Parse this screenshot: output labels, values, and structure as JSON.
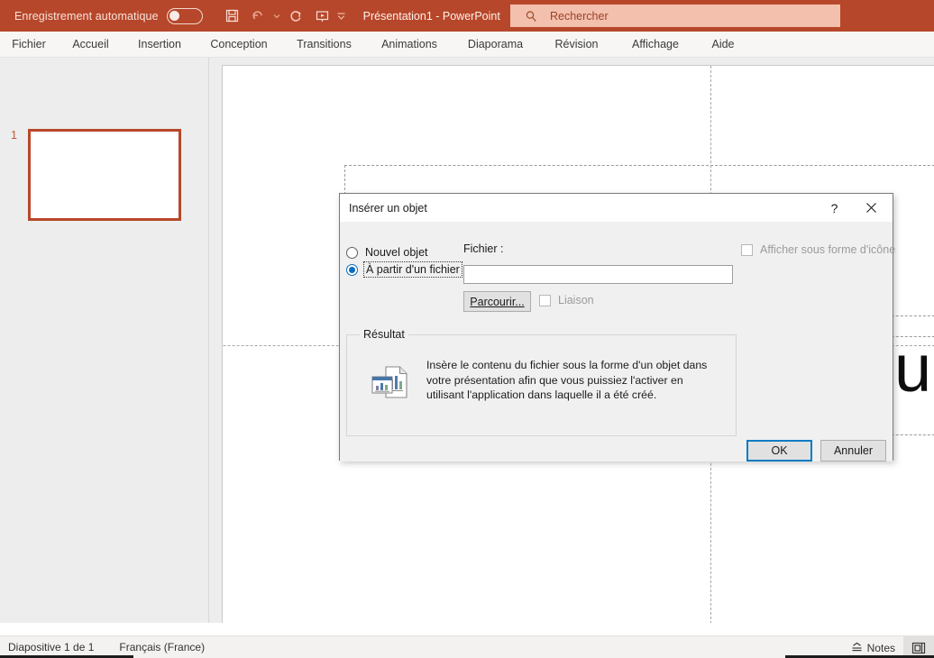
{
  "titlebar": {
    "autosave_label": "Enregistrement automatique",
    "autosave_state": "off",
    "qat": [
      {
        "name": "save-icon",
        "tooltip": "Enregistrer"
      },
      {
        "name": "undo-icon",
        "tooltip": "Annuler"
      },
      {
        "name": "undo-dropdown-icon",
        "tooltip": "Annuler (options)"
      },
      {
        "name": "redo-icon",
        "tooltip": "Rétablir"
      },
      {
        "name": "start-presentation-icon",
        "tooltip": "Démarrer à partir du début"
      },
      {
        "name": "customize-qat-icon",
        "tooltip": "Personnaliser la barre d'outils Accès rapide"
      }
    ],
    "document_title": "Présentation1  -  PowerPoint",
    "accent_color": "#b7472a",
    "search_bg": "#f3c0ad"
  },
  "search": {
    "placeholder": "Rechercher",
    "icon": "search-icon"
  },
  "ribbon": {
    "tabs": [
      {
        "label": "Fichier"
      },
      {
        "label": "Accueil"
      },
      {
        "label": "Insertion"
      },
      {
        "label": "Conception"
      },
      {
        "label": "Transitions"
      },
      {
        "label": "Animations"
      },
      {
        "label": "Diaporama"
      },
      {
        "label": "Révision"
      },
      {
        "label": "Affichage"
      },
      {
        "label": "Aide"
      }
    ]
  },
  "thumbnails": {
    "slides": [
      {
        "number": "1",
        "selected": true
      }
    ],
    "selection_color": "#b7472a"
  },
  "canvas": {
    "visible_text": "un",
    "placeholders": [
      "title-placeholder",
      "subtitle-placeholder"
    ]
  },
  "dialog": {
    "title": "Insérer un objet",
    "help_glyph": "?",
    "close_glyph": "✕",
    "source": {
      "option_new": "Nouvel objet",
      "option_from_file": "À partir d'un fichier",
      "selected": "from_file"
    },
    "file": {
      "label": "Fichier :",
      "value": "",
      "placeholder": "",
      "browse_label": "Parcourir...",
      "link_label": "Liaison",
      "link_checked": false,
      "link_disabled": true
    },
    "display_as_icon": {
      "label": "Afficher sous forme d'icône",
      "checked": false,
      "disabled": true
    },
    "result": {
      "legend": "Résultat",
      "icon": "document-chart-icon",
      "description": "Insère le contenu du fichier sous la forme d'un objet dans votre présentation afin que vous puissiez l'activer en utilisant l'application dans laquelle il a été créé."
    },
    "buttons": {
      "ok": "OK",
      "cancel": "Annuler",
      "default": "ok",
      "focus_color": "#0a7bc4"
    }
  },
  "statusbar": {
    "slide_indicator": "Diapositive 1 de 1",
    "language": "Français (France)",
    "notes_label": "Notes",
    "notes_icon": "notes-icon",
    "view_icon": "reading-view-icon"
  }
}
